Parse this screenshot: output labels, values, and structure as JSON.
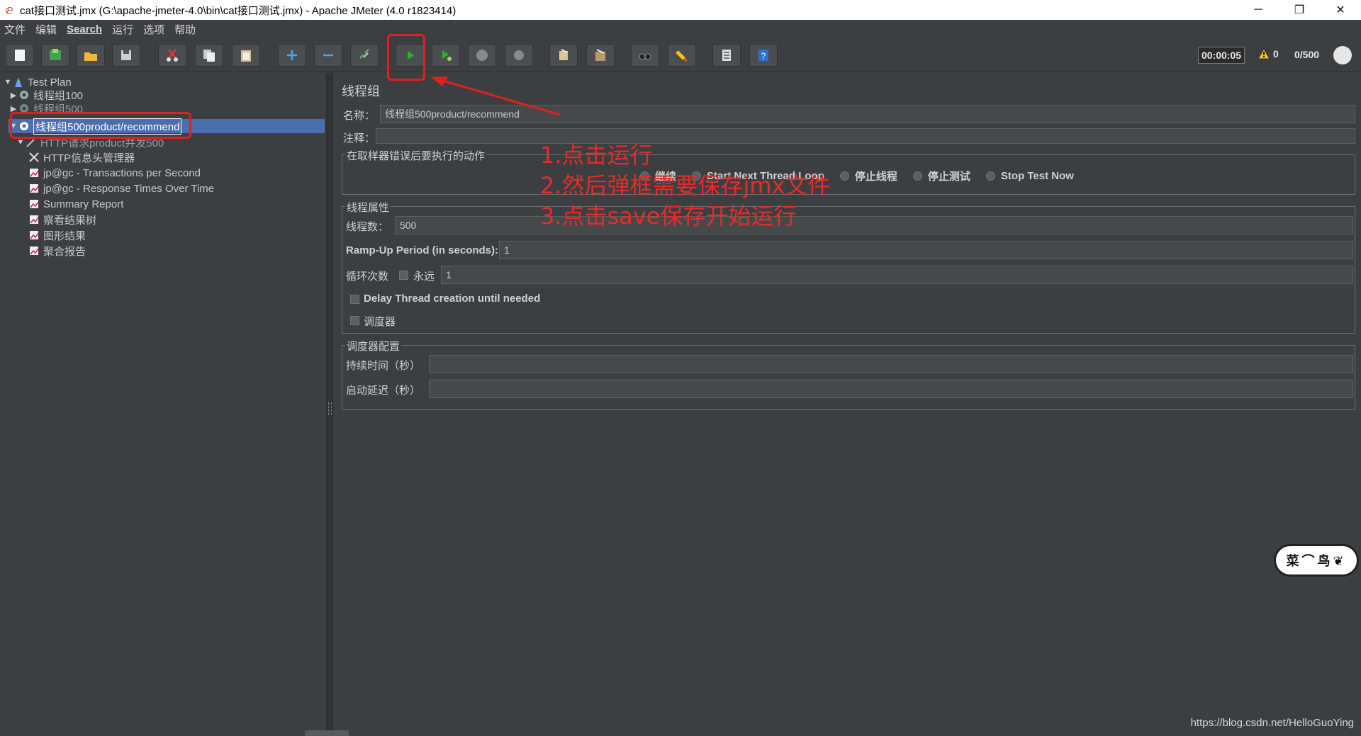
{
  "window": {
    "title": "cat接口测试.jmx (G:\\apache-jmeter-4.0\\bin\\cat接口测试.jmx) - Apache JMeter (4.0 r1823414)",
    "minimize": "─",
    "maximize": "❐",
    "close": "✕"
  },
  "menu": [
    "文件",
    "编辑",
    "Search",
    "运行",
    "选项",
    "帮助"
  ],
  "toolbar": {
    "buttons": [
      "new-icon",
      "templates-icon",
      "open-icon",
      "save-icon",
      "cut-icon",
      "copy-icon",
      "paste-icon",
      "expand-icon",
      "collapse-icon",
      "toggle-icon",
      "start-icon",
      "start-no-pause-icon",
      "stop-icon",
      "shutdown-icon",
      "clear-icon",
      "clear-all-icon",
      "search-icon",
      "reset-search-icon",
      "function-helper-icon",
      "help-icon"
    ],
    "timer": "00:00:05",
    "warnings": "0",
    "threads": "0/500"
  },
  "tree": {
    "test_plan": "Test Plan",
    "group1": "线程组100",
    "group2": "线程组500",
    "group3": "线程组500product/recommend",
    "sampler": "HTTP请求product并发500",
    "header_manager": "HTTP信息头管理器",
    "listener1": "jp@gc - Transactions per Second",
    "listener2": "jp@gc - Response Times Over Time",
    "listener3": "Summary Report",
    "listener4": "察看结果树",
    "listener5": "图形结果",
    "listener6": "聚合报告"
  },
  "panel": {
    "title": "线程组",
    "name_label": "名称：",
    "name_value": "线程组500product/recommend",
    "comment_label": "注释：",
    "error_group_label": "在取样器错误后要执行的动作",
    "error_actions": [
      "继续",
      "Start Next Thread Loop",
      "停止线程",
      "停止测试",
      "Stop Test Now"
    ],
    "props_group_label": "线程属性",
    "threads_label": "线程数：",
    "threads_value": "500",
    "rampup_label": "Ramp-Up Period (in seconds):",
    "rampup_value": "1",
    "loop_label": "循环次数",
    "forever_label": "永远",
    "loop_value": "1",
    "delay_label": "Delay Thread creation until needed",
    "scheduler_label": "调度器",
    "scheduler_group_label": "调度器配置",
    "duration_label": "持续时间（秒）",
    "startup_delay_label": "启动延迟（秒）"
  },
  "annotations": {
    "step1": "1.点击运行",
    "step2": "2.然后弹框需要保存jmx文件",
    "step3": "3.点击save保存开始运行",
    "color": "#e82a2a"
  },
  "watermark": "https://blog.csdn.net/HelloGuoYing",
  "badge": "菜⌒鸟❦"
}
